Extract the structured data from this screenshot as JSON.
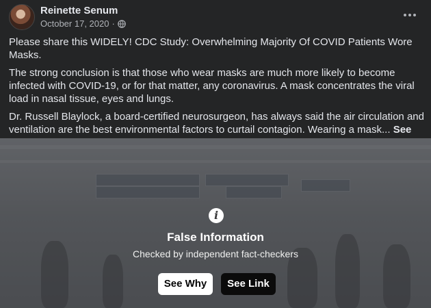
{
  "post": {
    "author": "Reinette Senum",
    "date": "October 17, 2020",
    "separator": "·",
    "audience_icon": "globe-icon",
    "paragraphs": [
      "Please share this WIDELY!  CDC Study: Overwhelming Majority Of COVID Patients Wore Masks.",
      "The strong conclusion is that those who wear masks are much more likely to become infected with COVID-19, or for that matter, any coronavirus. A mask concentrates the viral load in nasal tissue, eyes and lungs.",
      "Dr. Russell Blaylock, a board-certified neurosurgeon, has always said the air circulation and ventilation are the best environmental factors to curtail contagion. Wearing a mask..."
    ],
    "see_more": "See More",
    "more_icon": "more-options-icon"
  },
  "warning": {
    "icon": "info-icon",
    "icon_glyph": "i",
    "title": "False Information",
    "subtitle": "Checked by independent fact-checkers",
    "see_why": "See Why",
    "see_link": "See Link"
  },
  "colors": {
    "background": "#242526",
    "text": "#e4e6eb",
    "secondary_text": "#b0b3b8"
  }
}
